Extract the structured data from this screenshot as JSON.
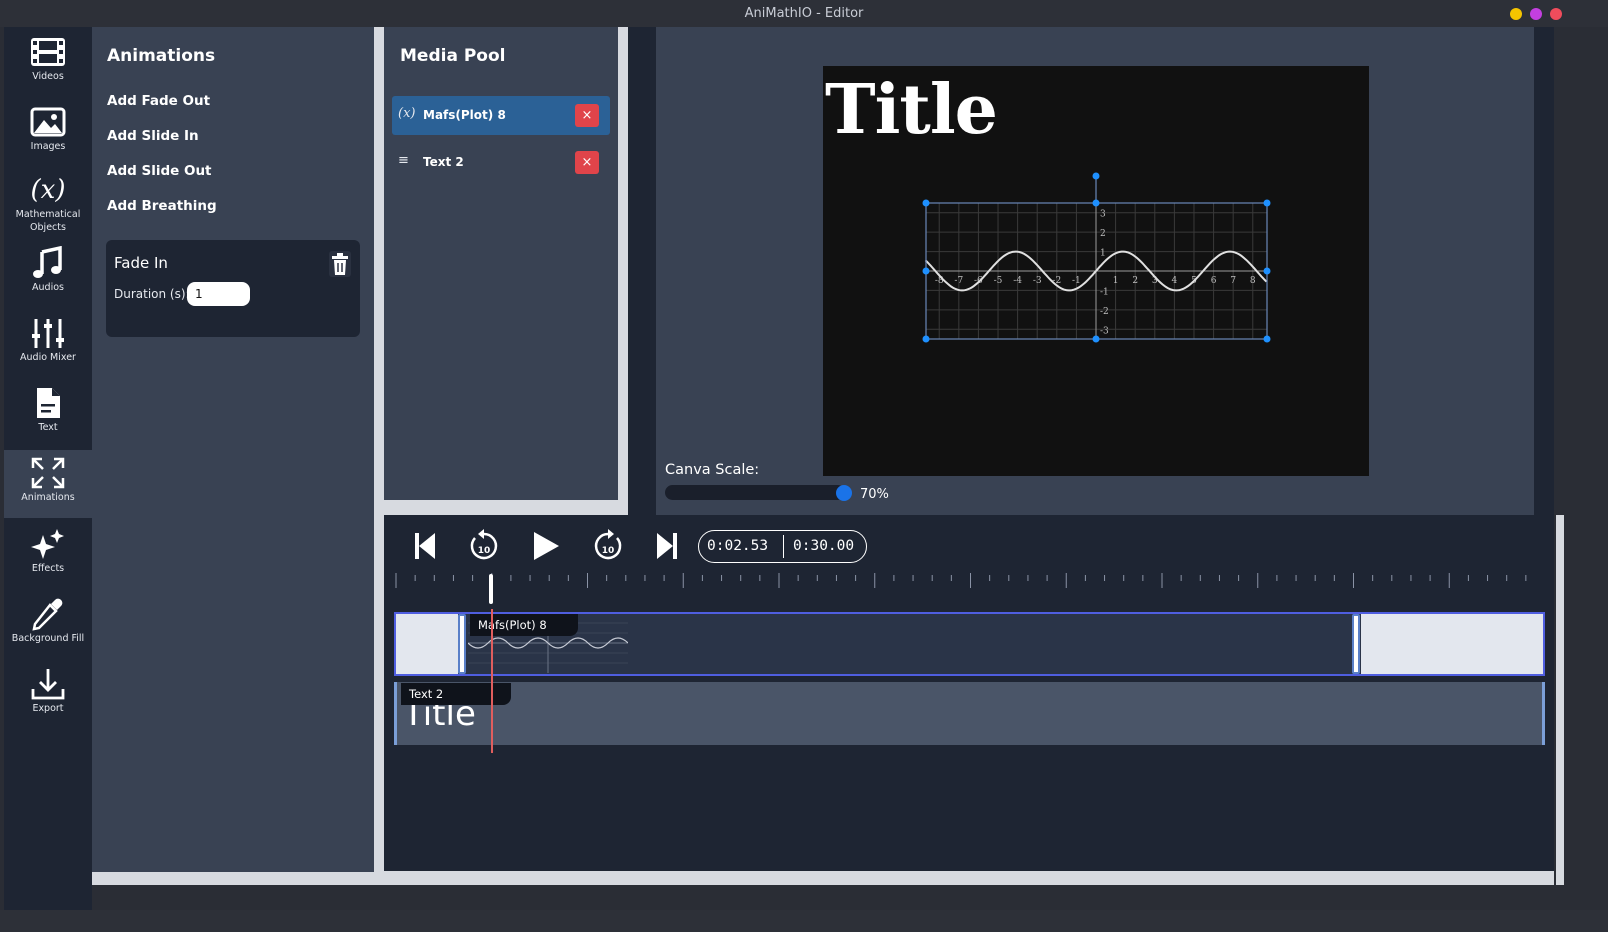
{
  "window": {
    "title": "AniMathIO - Editor",
    "buttons": {
      "minimize_color": "#f5c400",
      "maximize_color": "#c33fe0",
      "close_color": "#f04c5c"
    }
  },
  "sidebar": {
    "items": [
      {
        "label": "Videos",
        "icon": "film-icon"
      },
      {
        "label": "Images",
        "icon": "image-icon"
      },
      {
        "label": "Mathematical Objects",
        "icon": "function-icon"
      },
      {
        "label": "Audios",
        "icon": "music-icon"
      },
      {
        "label": "Audio Mixer",
        "icon": "sliders-icon"
      },
      {
        "label": "Text",
        "icon": "document-icon"
      },
      {
        "label": "Animations",
        "icon": "expand-icon",
        "active": true
      },
      {
        "label": "Effects",
        "icon": "sparkles-icon"
      },
      {
        "label": "Background Fill",
        "icon": "eyedropper-icon"
      },
      {
        "label": "Export",
        "icon": "download-icon"
      }
    ]
  },
  "animations": {
    "title": "Animations",
    "actions": [
      "Add Fade Out",
      "Add Slide In",
      "Add Slide Out",
      "Add Breathing"
    ],
    "card": {
      "title": "Fade In",
      "duration_label": "Duration (s):",
      "duration_value": "1"
    }
  },
  "media_pool": {
    "title": "Media Pool",
    "items": [
      {
        "icon_text": "(x)",
        "name": "Mafs(Plot) 8",
        "selected": true
      },
      {
        "icon_text": "≡",
        "name": "Text 2",
        "selected": false
      }
    ],
    "remove_glyph": "×"
  },
  "preview": {
    "canvas_title": "Title",
    "scale_label": "Canva Scale:",
    "scale_value": "70%",
    "scale_fraction": 0.7,
    "plot": {
      "x_ticks": [
        "-8",
        "-7",
        "-6",
        "-5",
        "-4",
        "-3",
        "-2",
        "-1",
        "1",
        "2",
        "3",
        "4",
        "5",
        "6",
        "7",
        "8"
      ],
      "y_ticks": [
        "3",
        "2",
        "1",
        "-1",
        "-2",
        "-3"
      ]
    }
  },
  "timeline": {
    "current_time": "0:02.53",
    "total_time": "0:30.00",
    "tracks": [
      {
        "label": "Mafs(Plot) 8"
      },
      {
        "label": "Text 2",
        "preview_text": "Title"
      }
    ]
  }
}
